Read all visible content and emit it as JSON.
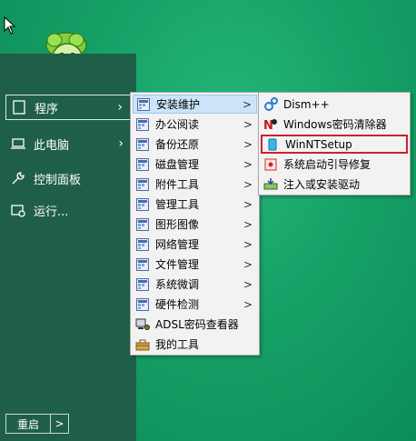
{
  "start_menu": {
    "items": [
      {
        "label": "程序",
        "icon": "document-icon",
        "has_arrow": true
      },
      {
        "label": "此电脑",
        "icon": "laptop-icon",
        "has_arrow": true
      },
      {
        "label": "控制面板",
        "icon": "wrench-icon",
        "has_arrow": false
      },
      {
        "label": "运行...",
        "icon": "run-icon",
        "has_arrow": false
      }
    ],
    "restart_label": "重启",
    "restart_arrow": ">"
  },
  "programs_menu": {
    "items": [
      {
        "label": "安装维护"
      },
      {
        "label": "办公阅读"
      },
      {
        "label": "备份还原"
      },
      {
        "label": "磁盘管理"
      },
      {
        "label": "附件工具"
      },
      {
        "label": "管理工具"
      },
      {
        "label": "图形图像"
      },
      {
        "label": "网络管理"
      },
      {
        "label": "文件管理"
      },
      {
        "label": "系统微调"
      },
      {
        "label": "硬件检测"
      },
      {
        "label": "ADSL密码查看器"
      },
      {
        "label": "我的工具"
      }
    ],
    "arrow": ">"
  },
  "install_menu": {
    "items": [
      {
        "label": "Dism++"
      },
      {
        "label": "Windows密码清除器"
      },
      {
        "label": "WinNTSetup"
      },
      {
        "label": "系统启动引导修复"
      },
      {
        "label": "注入或安装驱动"
      }
    ]
  },
  "colors": {
    "desktop": "#15a066",
    "panel": "#1f5f48",
    "menu_bg": "#f2f2f2",
    "highlight": "#cce4f7",
    "selection_box": "#d11f2a"
  }
}
